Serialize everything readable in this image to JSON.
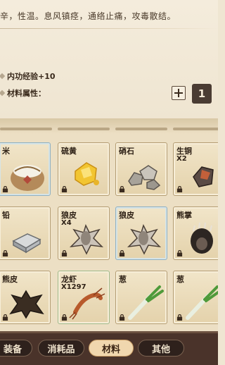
{
  "info": {
    "description": "辛，性温。息风镇痉，通络止痛，攻毒散结。",
    "stat_exp": "内功经验+10",
    "material_attr": "材料属性：",
    "count": "1",
    "plus": "+"
  },
  "items": [
    {
      "name": "米",
      "qty": "",
      "icon": "rice-sack-icon"
    },
    {
      "name": "硫黄",
      "qty": "",
      "icon": "sulfur-icon"
    },
    {
      "name": "硝石",
      "qty": "",
      "icon": "saltpeter-stones-icon"
    },
    {
      "name": "生铜",
      "qty": "X2",
      "icon": "raw-copper-icon"
    },
    {
      "name": "铅",
      "qty": "",
      "icon": "lead-ingot-icon"
    },
    {
      "name": "狼皮",
      "qty": "X4",
      "icon": "wolf-pelt-icon"
    },
    {
      "name": "狼皮",
      "qty": "",
      "icon": "wolf-pelt-icon"
    },
    {
      "name": "熊掌",
      "qty": "",
      "icon": "bear-paw-icon"
    },
    {
      "name": "熊皮",
      "qty": "",
      "icon": "bear-pelt-icon"
    },
    {
      "name": "龙虾",
      "qty": "X1297",
      "icon": "lobster-icon"
    },
    {
      "name": "葱",
      "qty": "",
      "icon": "scallion-icon"
    },
    {
      "name": "葱",
      "qty": "",
      "icon": "scallion-icon"
    }
  ],
  "tabs": [
    {
      "label": "装备",
      "active": false
    },
    {
      "label": "消耗品",
      "active": false
    },
    {
      "label": "材料",
      "active": true
    },
    {
      "label": "其他",
      "active": false
    }
  ],
  "colors": {
    "panel_bg": "#efe6d2",
    "tabbar_bg": "#4a332a",
    "active_tab": "#f0d7ae",
    "count_box": "#4a3c33"
  }
}
